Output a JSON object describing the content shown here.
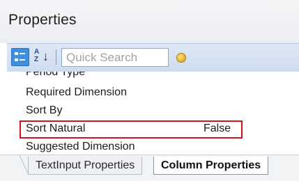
{
  "panel": {
    "title": "Properties"
  },
  "toolbar": {
    "search_placeholder": "Quick Search",
    "alpha_top": "A",
    "alpha_bottom": "Z",
    "alpha_arrow": "↓"
  },
  "properties": [
    {
      "name": "Period Type",
      "value": ""
    },
    {
      "name": "Required Dimension",
      "value": ""
    },
    {
      "name": "Sort By",
      "value": ""
    },
    {
      "name": "Sort Natural",
      "value": "False",
      "highlighted": true
    },
    {
      "name": "Suggested Dimension",
      "value": ""
    }
  ],
  "tabs": [
    {
      "label": "TextInput Properties",
      "active": false
    },
    {
      "label": "Column Properties",
      "active": true
    }
  ],
  "colors": {
    "highlight": "#d0121c",
    "toolbar_active": "#3f8fe0"
  }
}
